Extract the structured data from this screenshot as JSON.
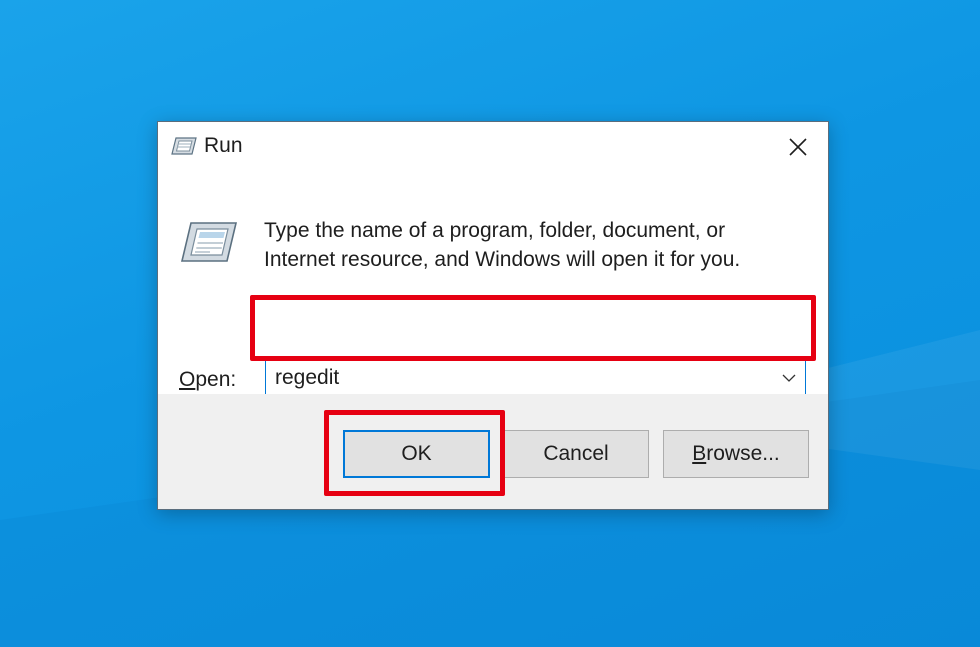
{
  "dialog": {
    "title": "Run",
    "title_icon": "run-icon",
    "close_icon": "close-icon",
    "run_icon": "run-program-icon",
    "description_line1": "Type the name of a program, folder, document, or",
    "description_line2": "Internet resource, and Windows will open it for you.",
    "open_label_mnemonic": "O",
    "open_label_rest": "pen:",
    "open_value": "regedit",
    "dropdown_icon": "chevron-down-icon",
    "buttons": {
      "ok": "OK",
      "cancel": "Cancel",
      "browse_mnemonic": "B",
      "browse_rest": "rowse..."
    }
  },
  "colors": {
    "desktop": "#0e96e3",
    "highlight": "#e60012",
    "focus": "#0078d7"
  }
}
